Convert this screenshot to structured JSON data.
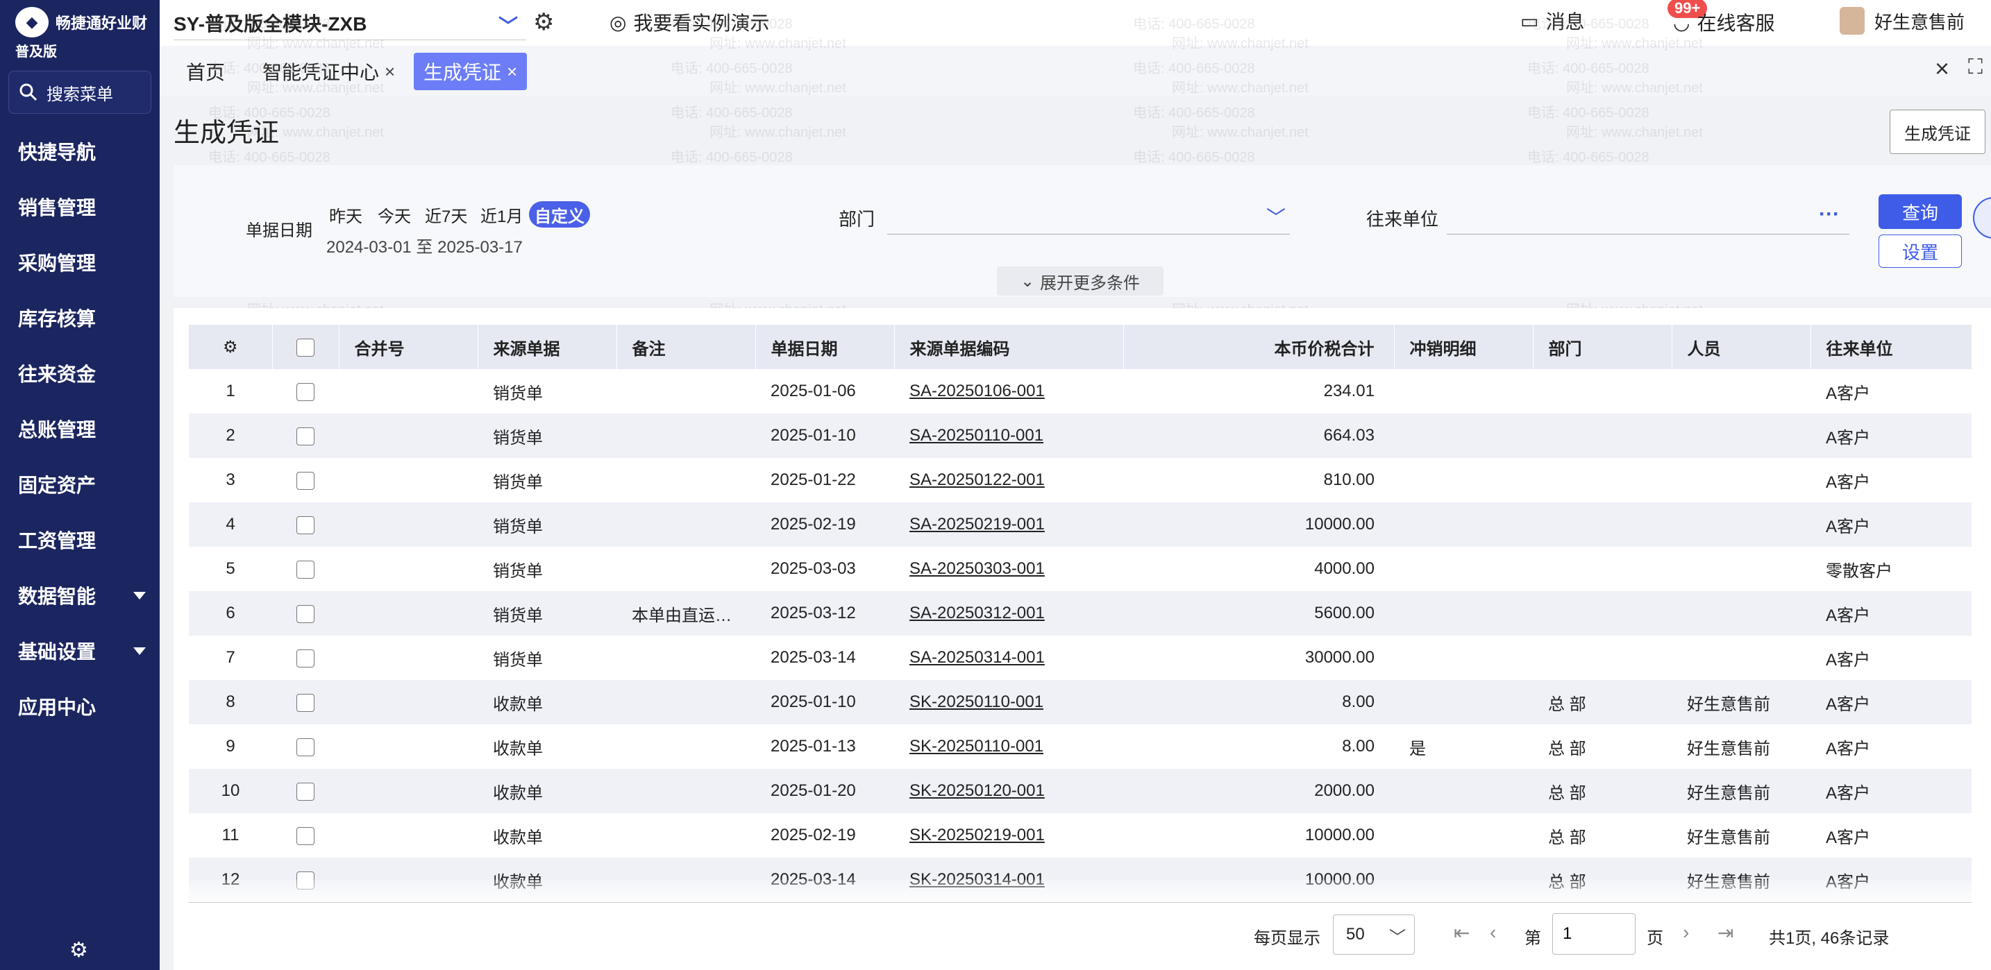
{
  "sidebar": {
    "logo_text": "畅捷通好业财",
    "edition": "普及版",
    "search_label": "搜索菜单",
    "items": [
      {
        "label": "快捷导航",
        "has_submenu": false
      },
      {
        "label": "销售管理",
        "has_submenu": false
      },
      {
        "label": "采购管理",
        "has_submenu": false
      },
      {
        "label": "库存核算",
        "has_submenu": false
      },
      {
        "label": "往来资金",
        "has_submenu": false
      },
      {
        "label": "总账管理",
        "has_submenu": false
      },
      {
        "label": "固定资产",
        "has_submenu": false
      },
      {
        "label": "工资管理",
        "has_submenu": false
      },
      {
        "label": "数据智能",
        "has_submenu": true
      },
      {
        "label": "基础设置",
        "has_submenu": true
      },
      {
        "label": "应用中心",
        "has_submenu": false
      }
    ],
    "bg_color": "#1b2660"
  },
  "header": {
    "account": "SY-普及版全模块-ZXB",
    "demo_link": "我要看实例演示",
    "messages_label": "消息",
    "messages_badge": "99+",
    "support_label": "在线客服",
    "user_name": "好生意售前"
  },
  "tabs": [
    {
      "label": "首页",
      "closable": false,
      "active": false
    },
    {
      "label": "智能凭证中心",
      "closable": true,
      "active": false
    },
    {
      "label": "生成凭证",
      "closable": true,
      "active": true
    }
  ],
  "page": {
    "title": "生成凭证",
    "generate_button": "生成凭证"
  },
  "filters": {
    "date_label": "单据日期",
    "quick_ranges": [
      "昨天",
      "今天",
      "近7天",
      "近1月",
      "自定义"
    ],
    "active_range": "自定义",
    "date_range": "2024-03-01 至 2025-03-17",
    "dept_label": "部门",
    "dept_value": "",
    "partner_label": "往来单位",
    "partner_value": "",
    "query_button": "查询",
    "settings_button": "设置",
    "expand_label": "展开更多条件"
  },
  "table": {
    "columns": [
      "合并号",
      "来源单据",
      "备注",
      "单据日期",
      "来源单据编码",
      "本币价税合计",
      "冲销明细",
      "部门",
      "人员",
      "往来单位"
    ],
    "rows": [
      {
        "no": "1",
        "merge": "",
        "source": "销货单",
        "remark": "",
        "date": "2025-01-06",
        "code": "SA-20250106-001",
        "amount": "234.01",
        "writeoff": "",
        "dept": "",
        "person": "",
        "partner": "A客户"
      },
      {
        "no": "2",
        "merge": "",
        "source": "销货单",
        "remark": "",
        "date": "2025-01-10",
        "code": "SA-20250110-001",
        "amount": "664.03",
        "writeoff": "",
        "dept": "",
        "person": "",
        "partner": "A客户"
      },
      {
        "no": "3",
        "merge": "",
        "source": "销货单",
        "remark": "",
        "date": "2025-01-22",
        "code": "SA-20250122-001",
        "amount": "810.00",
        "writeoff": "",
        "dept": "",
        "person": "",
        "partner": "A客户"
      },
      {
        "no": "4",
        "merge": "",
        "source": "销货单",
        "remark": "",
        "date": "2025-02-19",
        "code": "SA-20250219-001",
        "amount": "10000.00",
        "writeoff": "",
        "dept": "",
        "person": "",
        "partner": "A客户"
      },
      {
        "no": "5",
        "merge": "",
        "source": "销货单",
        "remark": "",
        "date": "2025-03-03",
        "code": "SA-20250303-001",
        "amount": "4000.00",
        "writeoff": "",
        "dept": "",
        "person": "",
        "partner": "零散客户"
      },
      {
        "no": "6",
        "merge": "",
        "source": "销货单",
        "remark": "本单由直运…",
        "date": "2025-03-12",
        "code": "SA-20250312-001",
        "amount": "5600.00",
        "writeoff": "",
        "dept": "",
        "person": "",
        "partner": "A客户"
      },
      {
        "no": "7",
        "merge": "",
        "source": "销货单",
        "remark": "",
        "date": "2025-03-14",
        "code": "SA-20250314-001",
        "amount": "30000.00",
        "writeoff": "",
        "dept": "",
        "person": "",
        "partner": "A客户"
      },
      {
        "no": "8",
        "merge": "",
        "source": "收款单",
        "remark": "",
        "date": "2025-01-10",
        "code": "SK-20250110-001",
        "amount": "8.00",
        "writeoff": "",
        "dept": "总 部",
        "person": "好生意售前",
        "partner": "A客户"
      },
      {
        "no": "9",
        "merge": "",
        "source": "收款单",
        "remark": "",
        "date": "2025-01-13",
        "code": "SK-20250110-001",
        "amount": "8.00",
        "writeoff": "是",
        "dept": "总 部",
        "person": "好生意售前",
        "partner": "A客户"
      },
      {
        "no": "10",
        "merge": "",
        "source": "收款单",
        "remark": "",
        "date": "2025-01-20",
        "code": "SK-20250120-001",
        "amount": "2000.00",
        "writeoff": "",
        "dept": "总 部",
        "person": "好生意售前",
        "partner": "A客户"
      },
      {
        "no": "11",
        "merge": "",
        "source": "收款单",
        "remark": "",
        "date": "2025-02-19",
        "code": "SK-20250219-001",
        "amount": "10000.00",
        "writeoff": "",
        "dept": "总 部",
        "person": "好生意售前",
        "partner": "A客户"
      },
      {
        "no": "12",
        "merge": "",
        "source": "收款单",
        "remark": "",
        "date": "2025-03-14",
        "code": "SK-20250314-001",
        "amount": "10000.00",
        "writeoff": "",
        "dept": "总 部",
        "person": "好生意售前",
        "partner": "A客户"
      }
    ]
  },
  "pagination": {
    "page_size_label": "每页显示",
    "page_size": "50",
    "page_prefix": "第",
    "page_value": "1",
    "page_suffix": "页",
    "summary": "共1页, 46条记录"
  },
  "watermark": {
    "phone": "电话: 400-665-0028",
    "site": "网址: www.chanjet.net"
  },
  "accent_color": "#3f5ce8"
}
